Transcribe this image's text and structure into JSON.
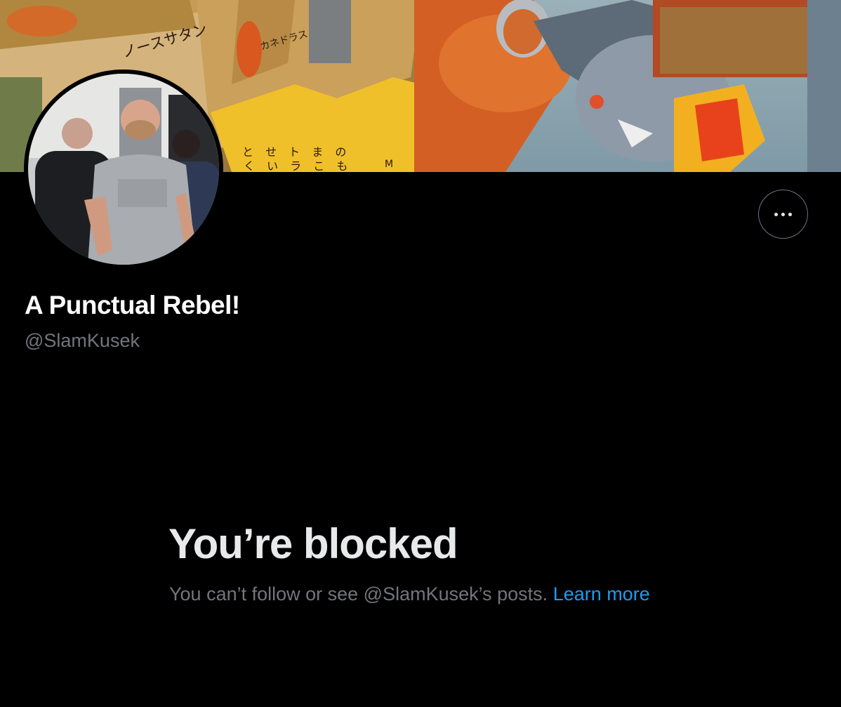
{
  "profile": {
    "display_name": "A Punctual Rebel!",
    "handle": "@SlamKusek"
  },
  "banner": {
    "text_1": "ノースサタン",
    "text_2": "カネドラス",
    "text_3": "と せ ト ま の",
    "text_4": "く い ラ こ も",
    "text_5": "M"
  },
  "blocked": {
    "title": "You’re blocked",
    "description": "You can’t follow or see @SlamKusek’s posts. ",
    "link_label": "Learn more"
  },
  "icons": {
    "more": "more-horizontal-icon"
  },
  "colors": {
    "background": "#000000",
    "text_primary": "#e7e9ea",
    "text_secondary": "#71767b",
    "link": "#1d9bf0"
  }
}
